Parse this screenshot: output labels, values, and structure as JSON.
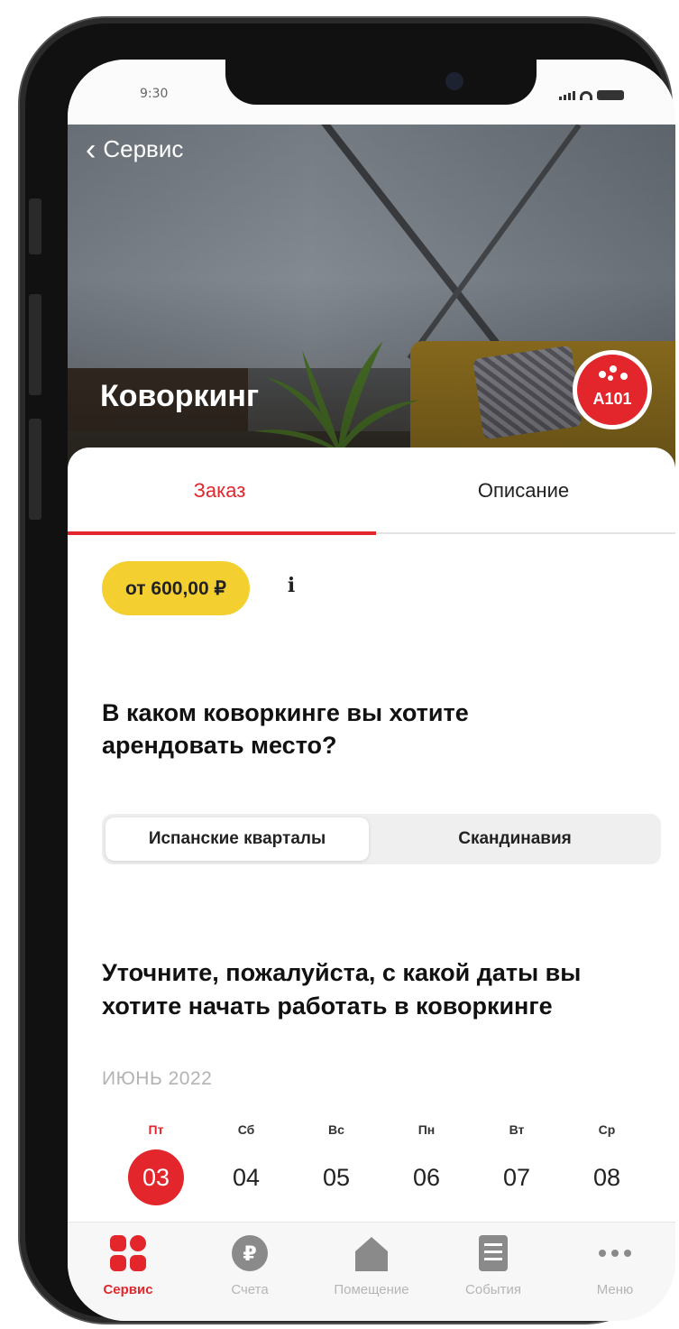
{
  "status_bar": {
    "time": "9:30"
  },
  "header": {
    "back_label": "Сервис",
    "title": "Коворкинг",
    "brand": "A101"
  },
  "tabs": [
    {
      "label": "Заказ",
      "active": true
    },
    {
      "label": "Описание",
      "active": false
    }
  ],
  "price": {
    "label": "от 600,00 ₽"
  },
  "info_icon": "i",
  "question_location": {
    "text": "В каком коворкинге вы хотите арендовать место?",
    "options": [
      {
        "label": "Испанские кварталы",
        "selected": true
      },
      {
        "label": "Скандинавия",
        "selected": false
      }
    ]
  },
  "question_date": {
    "text": "Уточните, пожалуйста, с какой даты вы хотите начать работать в коворкинге",
    "month": "ИЮНЬ 2022",
    "days": [
      {
        "weekday": "Пт",
        "date": "03",
        "selected": true
      },
      {
        "weekday": "Сб",
        "date": "04",
        "selected": false
      },
      {
        "weekday": "Вс",
        "date": "05",
        "selected": false
      },
      {
        "weekday": "Пн",
        "date": "06",
        "selected": false
      },
      {
        "weekday": "Вт",
        "date": "07",
        "selected": false
      },
      {
        "weekday": "Ср",
        "date": "08",
        "selected": false
      }
    ]
  },
  "tabbar": [
    {
      "label": "Сервис",
      "icon": "grid-icon",
      "active": true
    },
    {
      "label": "Счета",
      "icon": "ruble-icon",
      "active": false
    },
    {
      "label": "Помещение",
      "icon": "house-icon",
      "active": false
    },
    {
      "label": "События",
      "icon": "document-icon",
      "active": false
    },
    {
      "label": "Меню",
      "icon": "more-icon",
      "active": false
    }
  ],
  "colors": {
    "accent": "#e2262c",
    "price_pill": "#f4cf30",
    "muted": "#b5b5b5"
  }
}
